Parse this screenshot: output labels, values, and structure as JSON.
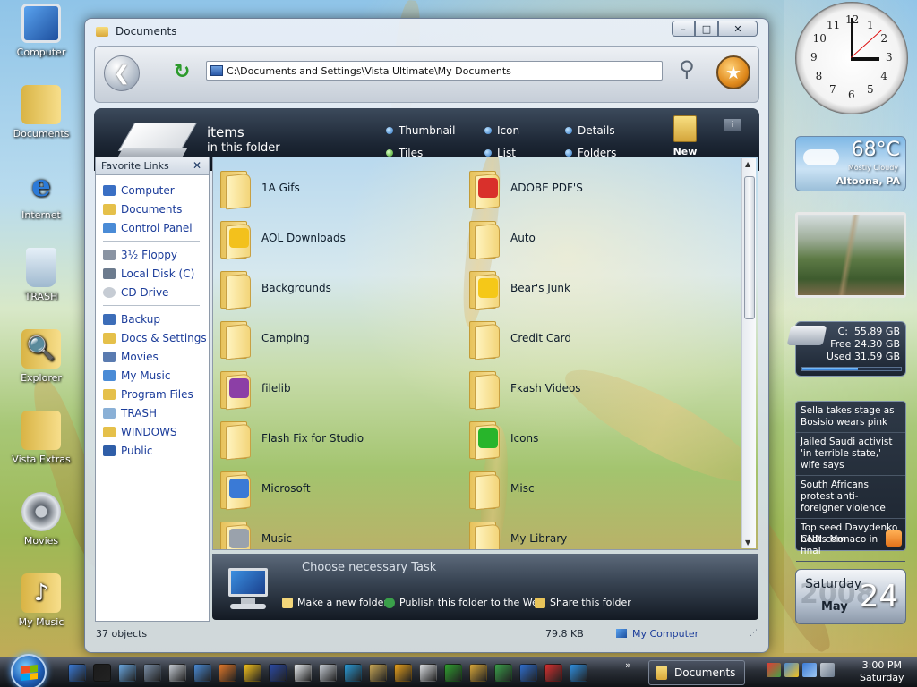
{
  "desktop": {
    "icons": [
      {
        "label": "Computer",
        "icon": "computer-icon"
      },
      {
        "label": "Documents",
        "icon": "documents-folder-icon"
      },
      {
        "label": "Internet",
        "icon": "internet-explorer-icon"
      },
      {
        "label": "TRASH",
        "icon": "recycle-bin-icon"
      },
      {
        "label": "Explorer",
        "icon": "explorer-icon"
      },
      {
        "label": "Vista Extras",
        "icon": "folder-icon"
      },
      {
        "label": "Movies",
        "icon": "film-reel-icon"
      },
      {
        "label": "My Music",
        "icon": "music-folder-icon"
      }
    ]
  },
  "window": {
    "title": "Documents",
    "minimize": "–",
    "maximize": "□",
    "close": "✕",
    "address": "C:\\Documents and Settings\\Vista Ultimate\\My Documents",
    "back_icon": "back-arrow-icon",
    "refresh_icon": "refresh-icon",
    "search_icon": "search-icon",
    "favorites_icon": "star-icon"
  },
  "banner": {
    "title": "items",
    "subtitle": "in this folder",
    "view_options": [
      {
        "label": "Thumbnail"
      },
      {
        "label": "Icon"
      },
      {
        "label": "Details"
      },
      {
        "label": "Tiles"
      },
      {
        "label": "List"
      },
      {
        "label": "Folders"
      }
    ],
    "new_folder": "New folder",
    "info": "i"
  },
  "favorites": {
    "title": "Favorite Links",
    "close": "✕",
    "group1": [
      {
        "label": "Computer",
        "color": "#3a6fc4"
      },
      {
        "label": "Documents",
        "color": "#e5c04a"
      },
      {
        "label": "Control Panel",
        "color": "#4a8bd6"
      }
    ],
    "group2": [
      {
        "label": "3½ Floppy",
        "color": "#8a94a3"
      },
      {
        "label": "Local Disk (C)",
        "color": "#6c7b8e"
      },
      {
        "label": "CD Drive",
        "color": "#c6ccd4"
      }
    ],
    "group3": [
      {
        "label": "Backup",
        "color": "#3c6db8"
      },
      {
        "label": "Docs & Settings",
        "color": "#e5c04a"
      },
      {
        "label": "Movies",
        "color": "#5a7bb0"
      },
      {
        "label": "My Music",
        "color": "#4a8bd6"
      },
      {
        "label": "Program Files",
        "color": "#e5c04a"
      },
      {
        "label": "TRASH",
        "color": "#8ab0d6"
      },
      {
        "label": "WINDOWS",
        "color": "#e5c04a"
      },
      {
        "label": "Public",
        "color": "#2f5ea8"
      }
    ]
  },
  "files": {
    "left": [
      {
        "name": "1A Gifs",
        "badge": ""
      },
      {
        "name": "AOL Downloads",
        "badge": "#f3c11c"
      },
      {
        "name": "Backgrounds",
        "badge": ""
      },
      {
        "name": "Camping",
        "badge": ""
      },
      {
        "name": "filelib",
        "badge": "#8c3fa6"
      },
      {
        "name": "Flash Fix for Studio",
        "badge": ""
      },
      {
        "name": "Microsoft",
        "badge": "#3a7ad6"
      },
      {
        "name": "Music",
        "badge": "#9aa2ac"
      }
    ],
    "right": [
      {
        "name": "ADOBE PDF'S",
        "badge": "#d9302b"
      },
      {
        "name": "Auto",
        "badge": ""
      },
      {
        "name": "Bear's Junk",
        "badge": "#f5c818"
      },
      {
        "name": "Credit Card",
        "badge": ""
      },
      {
        "name": "Fkash Videos",
        "badge": ""
      },
      {
        "name": "Icons",
        "badge": "#28b52b"
      },
      {
        "name": "Misc",
        "badge": ""
      },
      {
        "name": "My Library",
        "badge": ""
      }
    ]
  },
  "tasks": {
    "title": "Choose necessary Task",
    "links": [
      {
        "label": "Make a new folder",
        "color": "#f3d67a"
      },
      {
        "label": "Publish this folder to the Web",
        "color": "#3aa04a"
      },
      {
        "label": "Share this folder",
        "color": "#e8c45a"
      }
    ]
  },
  "status": {
    "objects": "37 objects",
    "size": "79.8 KB",
    "location": "My Computer"
  },
  "gadgets": {
    "clock": {
      "numbers": [
        "12",
        "1",
        "2",
        "3",
        "4",
        "5",
        "6",
        "7",
        "8",
        "9",
        "10",
        "11"
      ],
      "time": "3:00"
    },
    "weather": {
      "temp": "68°C",
      "condition": "Mostly Cloudy",
      "location": "Altoona, PA"
    },
    "drive": {
      "letter": "C:",
      "total": "55.89 GB",
      "free_label": "Free",
      "free": "24.30 GB",
      "used_label": "Used",
      "used": "31.59 GB",
      "used_fraction": 0.565
    },
    "news": {
      "items": [
        "Sella takes stage as Bosisio wears pink",
        "Jailed Saudi activist 'in terrible state,' wife says",
        "South Africans protest anti-foreigner violence",
        "Top seed Davydenko beats Monaco in final"
      ],
      "source": "CNN.com"
    },
    "calendar": {
      "weekday": "Saturday",
      "month": "May",
      "day": "24",
      "year": "2008"
    }
  },
  "taskbar": {
    "window_button": "Documents",
    "expand": "»",
    "time": "3:00 PM",
    "day": "Saturday"
  }
}
